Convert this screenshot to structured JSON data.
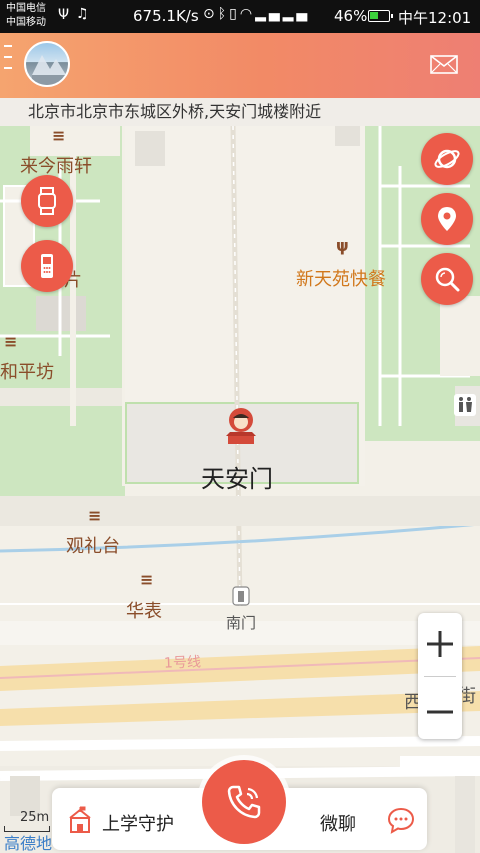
{
  "status_bar": {
    "carrier_1": "中国电信",
    "carrier_2": "中国移动",
    "net_speed": "675.1K/s",
    "battery_percent": "46%",
    "battery_level": 0.46,
    "time": "中午12:01",
    "battery_color": "#3cd13c"
  },
  "header": {
    "background_gradient": [
      "#f5a46f",
      "#ee7f73"
    ],
    "menu_icon": "hamburger-icon",
    "mail_icon": "envelope-icon"
  },
  "address": {
    "text": "北京市北京市东城区外桥,天安门城楼附近"
  },
  "map": {
    "labels": {
      "laijin": "来今雨轩",
      "pian": "片",
      "heping": "和平坊",
      "xintianyuan": "新天苑快餐",
      "tiananmen": "天安门",
      "guanlitai": "观礼台",
      "huabiao": "华表",
      "nanmen": "南门",
      "line1": "1号线",
      "xi": "西",
      "jie": "街"
    },
    "scale_label": "25m",
    "watermark": "高德地"
  },
  "side_buttons": {
    "left": [
      "watch-icon",
      "phone-icon"
    ],
    "right": [
      "planet-icon",
      "location-pin-icon",
      "search-zoom-icon"
    ],
    "color": "#ec5b49"
  },
  "zoom": {
    "plus": "+",
    "minus": "−"
  },
  "bottom_bar": {
    "school_label": "上学守护",
    "chat_label": "微聊",
    "call_icon": "phone-call-icon"
  }
}
